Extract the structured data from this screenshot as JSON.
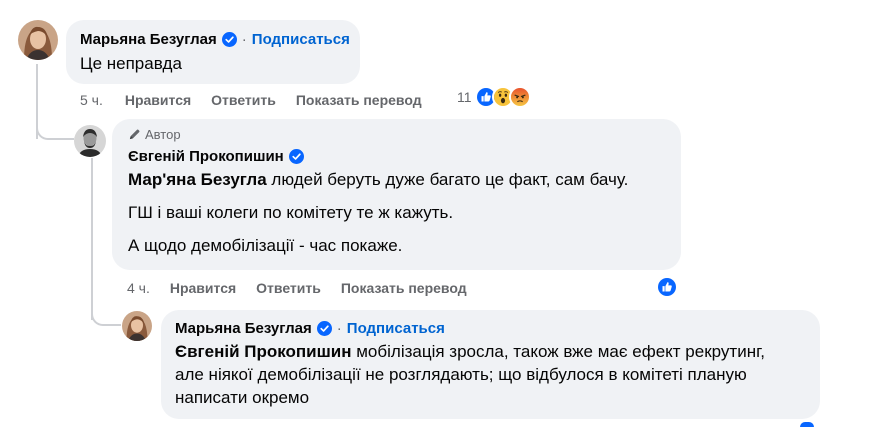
{
  "comment1": {
    "author": "Марьяна Безуглая",
    "follow": "Подписаться",
    "text": "Це неправда",
    "time": "5 ч.",
    "like": "Нравится",
    "reply": "Ответить",
    "translate": "Показать перевод",
    "reaction_count": "11",
    "reactions": [
      "like-icon",
      "wow-icon",
      "angry-icon"
    ]
  },
  "comment2": {
    "badge": "Автор",
    "author": "Євгеній Прокопишин",
    "mention": "Мар'яна Безугла",
    "line1": " людей беруть дуже багато це факт, сам бачу.",
    "line2": "ГШ і ваші колеги по комітету те ж кажуть.",
    "line3": "А щодо демобілізації - час покаже.",
    "time": "4 ч.",
    "like": "Нравится",
    "reply": "Ответить",
    "translate": "Показать перевод",
    "reactions": [
      "like-icon"
    ]
  },
  "comment3": {
    "author": "Марьяна Безуглая",
    "follow": "Подписаться",
    "mention": "Євгеній Прокопишин",
    "text": " мобілізація зросла, також вже має ефект рекрутинг, але ніякої демобілізації не розглядають; що відбулося в комітеті планую написати окремо"
  },
  "colors": {
    "bubble": "#f0f2f5",
    "secondary_text": "#65676b",
    "link_blue": "#0064d1",
    "verified_blue": "#0866ff",
    "thread_line": "#ced0d4"
  }
}
